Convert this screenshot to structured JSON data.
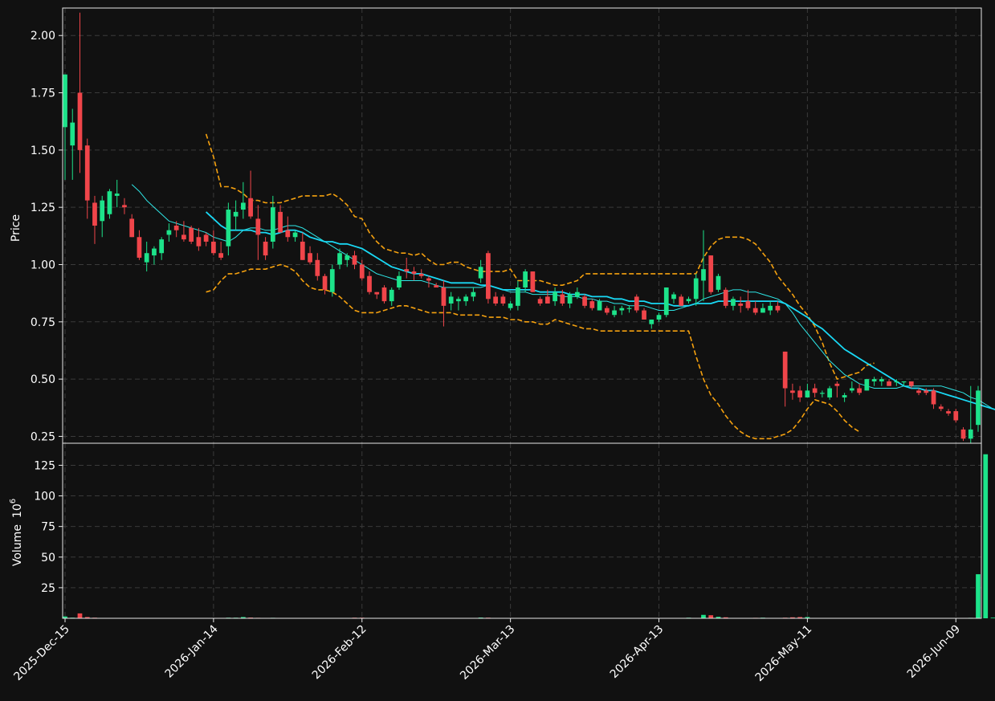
{
  "chart_data": {
    "type": "candlestick",
    "colors": {
      "background": "#111111",
      "up": "#1de38a",
      "down": "#f0454a",
      "ma_fast": "#2ee6e6",
      "ma_slow": "#19d9f5",
      "bollinger": "#f5a10f",
      "grid": "#3a3a3a",
      "text": "#ffffff"
    },
    "price_panel": {
      "ylabel": "Price",
      "ylim": [
        0.22,
        2.12
      ],
      "yticks": [
        "0.25",
        "0.50",
        "0.75",
        "1.00",
        "1.25",
        "1.50",
        "1.75",
        "2.00"
      ],
      "ytick_values": [
        0.25,
        0.5,
        0.75,
        1.0,
        1.25,
        1.5,
        1.75,
        2.0
      ],
      "grid": true
    },
    "volume_panel": {
      "ylabel": "Volume",
      "ylabel_exponent": "10",
      "ylabel_power": "6",
      "ylim": [
        0,
        143
      ],
      "yticks": [
        "25",
        "50",
        "75",
        "100",
        "125"
      ],
      "ytick_values": [
        25,
        50,
        75,
        100,
        125
      ],
      "grid": true
    },
    "x_axis": {
      "n_bars": 124,
      "tick_labels": [
        "2025-Dec-15",
        "2026-Jan-14",
        "2026-Feb-12",
        "2026-Mar-13",
        "2026-Apr-13",
        "2026-May-11",
        "2026-Jun-09"
      ],
      "tick_index": [
        0,
        20,
        40,
        60,
        80,
        100,
        120
      ]
    },
    "ohlc": [
      [
        1.6,
        1.83,
        1.37,
        1.83
      ],
      [
        1.52,
        1.68,
        1.37,
        1.62
      ],
      [
        1.75,
        2.1,
        1.4,
        1.5
      ],
      [
        1.52,
        1.55,
        1.2,
        1.28
      ],
      [
        1.27,
        1.3,
        1.09,
        1.17
      ],
      [
        1.19,
        1.3,
        1.12,
        1.28
      ],
      [
        1.22,
        1.33,
        1.2,
        1.32
      ],
      [
        1.3,
        1.37,
        1.25,
        1.31
      ],
      [
        1.26,
        1.29,
        1.22,
        1.25
      ],
      [
        1.2,
        1.22,
        1.12,
        1.12
      ],
      [
        1.12,
        1.15,
        1.02,
        1.03
      ],
      [
        1.01,
        1.1,
        0.97,
        1.05
      ],
      [
        1.04,
        1.08,
        1.0,
        1.07
      ],
      [
        1.05,
        1.12,
        1.02,
        1.11
      ],
      [
        1.13,
        1.18,
        1.1,
        1.15
      ],
      [
        1.17,
        1.19,
        1.12,
        1.15
      ],
      [
        1.13,
        1.19,
        1.1,
        1.11
      ],
      [
        1.16,
        1.17,
        1.09,
        1.1
      ],
      [
        1.12,
        1.16,
        1.06,
        1.08
      ],
      [
        1.13,
        1.14,
        1.08,
        1.1
      ],
      [
        1.1,
        1.15,
        1.04,
        1.05
      ],
      [
        1.05,
        1.1,
        1.02,
        1.03
      ],
      [
        1.08,
        1.27,
        1.04,
        1.24
      ],
      [
        1.21,
        1.28,
        1.15,
        1.23
      ],
      [
        1.24,
        1.36,
        1.2,
        1.27
      ],
      [
        1.29,
        1.41,
        1.2,
        1.21
      ],
      [
        1.2,
        1.26,
        1.02,
        1.13
      ],
      [
        1.1,
        1.12,
        1.02,
        1.04
      ],
      [
        1.1,
        1.3,
        1.07,
        1.25
      ],
      [
        1.23,
        1.26,
        1.14,
        1.14
      ],
      [
        1.15,
        1.21,
        1.1,
        1.12
      ],
      [
        1.12,
        1.15,
        1.1,
        1.14
      ],
      [
        1.1,
        1.14,
        1.02,
        1.02
      ],
      [
        1.05,
        1.08,
        1.0,
        1.01
      ],
      [
        1.02,
        1.05,
        0.93,
        0.95
      ],
      [
        0.95,
        0.96,
        0.87,
        0.89
      ],
      [
        0.88,
        1.0,
        0.86,
        0.98
      ],
      [
        1.0,
        1.07,
        0.98,
        1.05
      ],
      [
        1.02,
        1.05,
        0.99,
        1.04
      ],
      [
        1.04,
        1.06,
        0.98,
        1.0
      ],
      [
        1.0,
        1.02,
        0.93,
        0.94
      ],
      [
        0.95,
        0.97,
        0.87,
        0.88
      ],
      [
        0.88,
        0.88,
        0.85,
        0.87
      ],
      [
        0.9,
        0.91,
        0.83,
        0.84
      ],
      [
        0.84,
        0.9,
        0.82,
        0.89
      ],
      [
        0.9,
        0.97,
        0.89,
        0.95
      ],
      [
        0.98,
        1.03,
        0.94,
        0.97
      ],
      [
        0.97,
        0.99,
        0.93,
        0.96
      ],
      [
        0.96,
        0.98,
        0.94,
        0.95
      ],
      [
        0.94,
        0.95,
        0.9,
        0.93
      ],
      [
        0.91,
        0.92,
        0.9,
        0.9
      ],
      [
        0.9,
        0.93,
        0.73,
        0.82
      ],
      [
        0.83,
        0.88,
        0.8,
        0.86
      ],
      [
        0.84,
        0.86,
        0.8,
        0.85
      ],
      [
        0.84,
        0.87,
        0.82,
        0.86
      ],
      [
        0.86,
        0.9,
        0.84,
        0.88
      ],
      [
        0.94,
        1.02,
        0.92,
        0.99
      ],
      [
        1.05,
        1.06,
        0.83,
        0.85
      ],
      [
        0.86,
        0.88,
        0.82,
        0.83
      ],
      [
        0.86,
        0.87,
        0.82,
        0.83
      ],
      [
        0.81,
        0.84,
        0.8,
        0.83
      ],
      [
        0.82,
        0.93,
        0.8,
        0.9
      ],
      [
        0.9,
        0.98,
        0.88,
        0.97
      ],
      [
        0.97,
        0.97,
        0.88,
        0.88
      ],
      [
        0.85,
        0.86,
        0.82,
        0.83
      ],
      [
        0.86,
        0.89,
        0.83,
        0.83
      ],
      [
        0.84,
        0.9,
        0.82,
        0.88
      ],
      [
        0.87,
        0.89,
        0.82,
        0.83
      ],
      [
        0.83,
        0.88,
        0.81,
        0.87
      ],
      [
        0.86,
        0.9,
        0.85,
        0.88
      ],
      [
        0.86,
        0.87,
        0.81,
        0.82
      ],
      [
        0.84,
        0.85,
        0.8,
        0.81
      ],
      [
        0.8,
        0.85,
        0.8,
        0.84
      ],
      [
        0.81,
        0.82,
        0.78,
        0.79
      ],
      [
        0.78,
        0.82,
        0.77,
        0.8
      ],
      [
        0.8,
        0.82,
        0.78,
        0.81
      ],
      [
        0.81,
        0.82,
        0.79,
        0.81
      ],
      [
        0.86,
        0.87,
        0.79,
        0.8
      ],
      [
        0.8,
        0.81,
        0.76,
        0.76
      ],
      [
        0.74,
        0.76,
        0.72,
        0.76
      ],
      [
        0.76,
        0.79,
        0.75,
        0.78
      ],
      [
        0.78,
        0.9,
        0.77,
        0.9
      ],
      [
        0.85,
        0.88,
        0.83,
        0.87
      ],
      [
        0.86,
        0.87,
        0.82,
        0.82
      ],
      [
        0.84,
        0.86,
        0.83,
        0.85
      ],
      [
        0.85,
        0.96,
        0.82,
        0.94
      ],
      [
        0.93,
        1.15,
        0.84,
        0.98
      ],
      [
        1.04,
        1.04,
        0.87,
        0.88
      ],
      [
        0.89,
        0.96,
        0.88,
        0.95
      ],
      [
        0.89,
        0.9,
        0.81,
        0.82
      ],
      [
        0.82,
        0.86,
        0.8,
        0.85
      ],
      [
        0.83,
        0.86,
        0.79,
        0.82
      ],
      [
        0.84,
        0.89,
        0.8,
        0.81
      ],
      [
        0.81,
        0.84,
        0.78,
        0.79
      ],
      [
        0.79,
        0.83,
        0.79,
        0.81
      ],
      [
        0.8,
        0.84,
        0.78,
        0.82
      ],
      [
        0.82,
        0.84,
        0.79,
        0.8
      ],
      [
        0.62,
        0.62,
        0.38,
        0.46
      ],
      [
        0.45,
        0.48,
        0.41,
        0.44
      ],
      [
        0.45,
        0.47,
        0.4,
        0.42
      ],
      [
        0.42,
        0.48,
        0.42,
        0.45
      ],
      [
        0.46,
        0.48,
        0.42,
        0.44
      ],
      [
        0.44,
        0.45,
        0.42,
        0.44
      ],
      [
        0.42,
        0.47,
        0.41,
        0.46
      ],
      [
        0.48,
        0.49,
        0.42,
        0.47
      ],
      [
        0.42,
        0.44,
        0.4,
        0.43
      ],
      [
        0.45,
        0.49,
        0.44,
        0.46
      ],
      [
        0.46,
        0.48,
        0.43,
        0.44
      ],
      [
        0.45,
        0.5,
        0.45,
        0.5
      ],
      [
        0.49,
        0.51,
        0.47,
        0.5
      ],
      [
        0.49,
        0.51,
        0.47,
        0.5
      ],
      [
        0.49,
        0.5,
        0.47,
        0.47
      ],
      [
        0.49,
        0.5,
        0.47,
        0.49
      ],
      [
        0.49,
        0.49,
        0.47,
        0.49
      ],
      [
        0.49,
        0.49,
        0.46,
        0.47
      ],
      [
        0.45,
        0.46,
        0.43,
        0.44
      ],
      [
        0.45,
        0.46,
        0.43,
        0.44
      ],
      [
        0.45,
        0.46,
        0.37,
        0.39
      ],
      [
        0.38,
        0.39,
        0.36,
        0.37
      ],
      [
        0.36,
        0.37,
        0.34,
        0.35
      ],
      [
        0.36,
        0.37,
        0.31,
        0.32
      ],
      [
        0.28,
        0.29,
        0.23,
        0.24
      ],
      [
        0.24,
        0.47,
        0.22,
        0.28
      ],
      [
        0.3,
        0.47,
        0.27,
        0.45
      ]
    ],
    "volume": [
      1.5,
      0.5,
      4,
      1,
      0.5,
      0.3,
      0.2,
      0.3,
      0.2,
      0.2,
      0.2,
      0.2,
      0.2,
      0.2,
      0.2,
      0.2,
      0.2,
      0.2,
      0.2,
      0.2,
      0.3,
      0.3,
      0.5,
      0.5,
      1,
      0.6,
      0.4,
      0.3,
      0.4,
      0.3,
      0.2,
      0.2,
      0.3,
      0.2,
      0.2,
      0.2,
      0.3,
      0.2,
      0.2,
      0.5,
      0.5,
      0.2,
      0.2,
      0.2,
      0.2,
      0.2,
      0.2,
      0.2,
      0.2,
      0.2,
      0.2,
      0.3,
      0.3,
      0.3,
      0.3,
      0.3,
      0.6,
      0.5,
      0.3,
      0.2,
      0.2,
      0.2,
      0.2,
      0.2,
      0.2,
      0.2,
      0.2,
      0.2,
      0.2,
      0.2,
      0.2,
      0.2,
      0.2,
      0.2,
      0.2,
      0.2,
      0.2,
      0.2,
      0.2,
      0.2,
      0.2,
      0.2,
      0.2,
      0.2,
      0.5,
      0.3,
      2.8,
      2.5,
      1.2,
      0.8,
      0.3,
      0.3,
      0.3,
      0.4,
      0.5,
      0.3,
      0.3,
      0.5,
      0.8,
      1.0,
      1.0,
      0.3,
      0.3,
      0.2,
      0.2,
      0.2,
      0.2,
      0.2,
      0.2,
      0.2,
      0.2,
      0.2,
      0.2,
      0.2,
      0.2,
      0.2,
      0.2,
      0.2,
      0.2,
      0.2,
      0.3,
      0.3,
      0.4,
      36,
      134,
      0.5
    ],
    "ma_fast": [
      null,
      null,
      null,
      null,
      null,
      null,
      null,
      null,
      null,
      1.35,
      1.32,
      1.28,
      1.25,
      1.22,
      1.19,
      1.18,
      1.17,
      1.16,
      1.15,
      1.14,
      1.12,
      1.11,
      1.1,
      1.12,
      1.15,
      1.16,
      1.16,
      1.15,
      1.15,
      1.16,
      1.17,
      1.17,
      1.16,
      1.14,
      1.12,
      1.1,
      1.08,
      1.06,
      1.04,
      1.02,
      1.0,
      0.98,
      0.96,
      0.95,
      0.94,
      0.93,
      0.93,
      0.93,
      0.93,
      0.92,
      0.91,
      0.9,
      0.9,
      0.9,
      0.9,
      0.9,
      0.9,
      0.91,
      0.9,
      0.89,
      0.88,
      0.88,
      0.88,
      0.87,
      0.87,
      0.87,
      0.87,
      0.86,
      0.86,
      0.86,
      0.85,
      0.85,
      0.84,
      0.84,
      0.83,
      0.83,
      0.82,
      0.82,
      0.82,
      0.81,
      0.8,
      0.8,
      0.8,
      0.81,
      0.82,
      0.83,
      0.85,
      0.86,
      0.87,
      0.88,
      0.89,
      0.89,
      0.88,
      0.88,
      0.87,
      0.86,
      0.85,
      0.83,
      0.79,
      0.74,
      0.7,
      0.66,
      0.62,
      0.58,
      0.55,
      0.52,
      0.5,
      0.48,
      0.47,
      0.46,
      0.46,
      0.46,
      0.46,
      0.47,
      0.47,
      0.47,
      0.47,
      0.47,
      0.47,
      0.46,
      0.45,
      0.44,
      0.42,
      0.41,
      0.39,
      0.37,
      0.36
    ],
    "ma_slow": [
      null,
      null,
      null,
      null,
      null,
      null,
      null,
      null,
      null,
      null,
      null,
      null,
      null,
      null,
      null,
      null,
      null,
      null,
      null,
      1.23,
      1.2,
      1.17,
      1.15,
      1.15,
      1.15,
      1.15,
      1.14,
      1.14,
      1.13,
      1.14,
      1.15,
      1.15,
      1.14,
      1.12,
      1.11,
      1.1,
      1.1,
      1.09,
      1.09,
      1.08,
      1.07,
      1.05,
      1.03,
      1.01,
      0.99,
      0.98,
      0.97,
      0.96,
      0.96,
      0.95,
      0.94,
      0.93,
      0.92,
      0.92,
      0.92,
      0.92,
      0.91,
      0.91,
      0.9,
      0.89,
      0.89,
      0.89,
      0.89,
      0.89,
      0.88,
      0.88,
      0.88,
      0.88,
      0.87,
      0.87,
      0.87,
      0.86,
      0.86,
      0.86,
      0.85,
      0.85,
      0.84,
      0.84,
      0.84,
      0.83,
      0.83,
      0.83,
      0.82,
      0.82,
      0.82,
      0.83,
      0.83,
      0.83,
      0.84,
      0.84,
      0.84,
      0.84,
      0.84,
      0.84,
      0.84,
      0.84,
      0.84,
      0.83,
      0.81,
      0.79,
      0.77,
      0.74,
      0.72,
      0.69,
      0.66,
      0.63,
      0.61,
      0.59,
      0.57,
      0.55,
      0.53,
      0.51,
      0.49,
      0.47,
      0.46,
      0.46,
      0.45,
      0.45,
      0.44,
      0.43,
      0.42,
      0.41,
      0.4,
      0.39,
      0.38,
      0.37,
      0.36
    ],
    "bollinger_upper": [
      null,
      null,
      null,
      null,
      null,
      null,
      null,
      null,
      null,
      null,
      null,
      null,
      null,
      null,
      null,
      null,
      null,
      null,
      null,
      1.57,
      1.47,
      1.34,
      1.34,
      1.33,
      1.31,
      1.28,
      1.28,
      1.27,
      1.27,
      1.27,
      1.28,
      1.29,
      1.3,
      1.3,
      1.3,
      1.3,
      1.31,
      1.29,
      1.26,
      1.21,
      1.2,
      1.14,
      1.1,
      1.07,
      1.06,
      1.05,
      1.05,
      1.04,
      1.05,
      1.02,
      1.0,
      1.0,
      1.01,
      1.01,
      0.99,
      0.98,
      0.97,
      0.97,
      0.97,
      0.97,
      0.98,
      0.93,
      0.93,
      0.93,
      0.93,
      0.92,
      0.91,
      0.91,
      0.92,
      0.93,
      0.96,
      0.96,
      0.96,
      0.96,
      0.96,
      0.96,
      0.96,
      0.96,
      0.96,
      0.96,
      0.96,
      0.96,
      0.96,
      0.96,
      0.96,
      0.96,
      1.03,
      1.08,
      1.11,
      1.12,
      1.12,
      1.12,
      1.11,
      1.09,
      1.05,
      1.01,
      0.95,
      0.91,
      0.87,
      0.82,
      0.78,
      0.73,
      0.66,
      0.57,
      0.5,
      0.51,
      0.52,
      0.53,
      0.56,
      0.57,
      null,
      null,
      null,
      null,
      null,
      null,
      null,
      null,
      null,
      null,
      null,
      null,
      null,
      null,
      null,
      null,
      null,
      null
    ],
    "bollinger_lower": [
      null,
      null,
      null,
      null,
      null,
      null,
      null,
      null,
      null,
      null,
      null,
      null,
      null,
      null,
      null,
      null,
      null,
      null,
      null,
      0.88,
      0.89,
      0.93,
      0.96,
      0.96,
      0.97,
      0.98,
      0.98,
      0.98,
      0.99,
      1.0,
      0.99,
      0.97,
      0.93,
      0.9,
      0.89,
      0.89,
      0.88,
      0.86,
      0.83,
      0.8,
      0.79,
      0.79,
      0.79,
      0.8,
      0.81,
      0.82,
      0.82,
      0.81,
      0.8,
      0.79,
      0.79,
      0.79,
      0.79,
      0.78,
      0.78,
      0.78,
      0.78,
      0.77,
      0.77,
      0.77,
      0.76,
      0.76,
      0.75,
      0.75,
      0.74,
      0.74,
      0.76,
      0.75,
      0.74,
      0.73,
      0.72,
      0.72,
      0.71,
      0.71,
      0.71,
      0.71,
      0.71,
      0.71,
      0.71,
      0.71,
      0.71,
      0.71,
      0.71,
      0.71,
      0.71,
      0.6,
      0.5,
      0.43,
      0.39,
      0.34,
      0.3,
      0.27,
      0.25,
      0.24,
      0.24,
      0.24,
      0.25,
      0.26,
      0.28,
      0.32,
      0.37,
      0.41,
      0.4,
      0.39,
      0.36,
      0.32,
      0.29,
      0.27,
      null,
      null,
      null,
      null,
      null,
      null,
      null,
      null,
      null,
      null,
      null,
      null,
      null,
      null,
      null,
      null,
      null,
      null,
      null,
      null
    ]
  }
}
